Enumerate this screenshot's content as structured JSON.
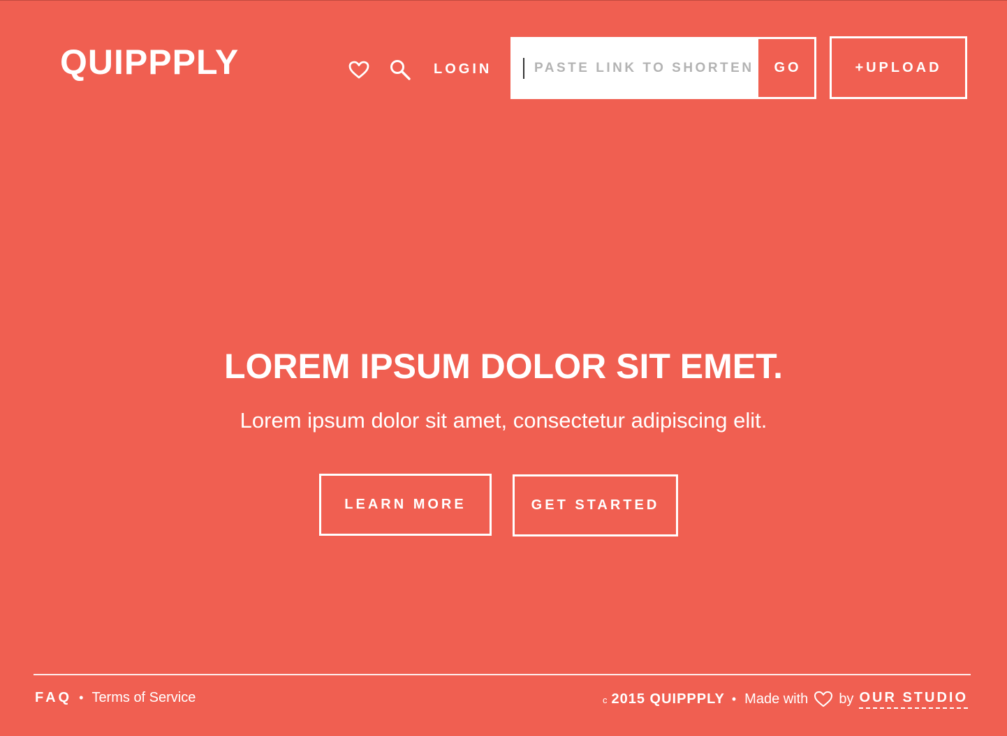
{
  "colors": {
    "background": "#f05f51",
    "foreground": "#ffffff",
    "input_background": "#ffffff",
    "placeholder": "#b3b3b3"
  },
  "header": {
    "logo": "QUIPPPLY",
    "favorites_icon": "heart-icon",
    "search_icon": "search-icon",
    "login_label": "LOGIN",
    "shorten_placeholder": "PASTE LINK TO SHORTEN",
    "shorten_value": "",
    "go_label": "GO",
    "upload_label": "+UPLOAD"
  },
  "hero": {
    "title": "LOREM IPSUM DOLOR SIT EMET.",
    "subtitle": "Lorem ipsum dolor sit amet, consectetur adipiscing elit.",
    "learn_more_label": "LEARN MORE",
    "get_started_label": "GET STARTED"
  },
  "footer": {
    "faq_label": "FAQ",
    "separator": "•",
    "terms_label": "Terms of Service",
    "copyright_mark": "c",
    "copyright_text": "2015 QUIPPPLY",
    "made_with": "Made with",
    "heart_icon": "heart-icon",
    "by": "by",
    "studio_label": "OUR STUDIO"
  }
}
